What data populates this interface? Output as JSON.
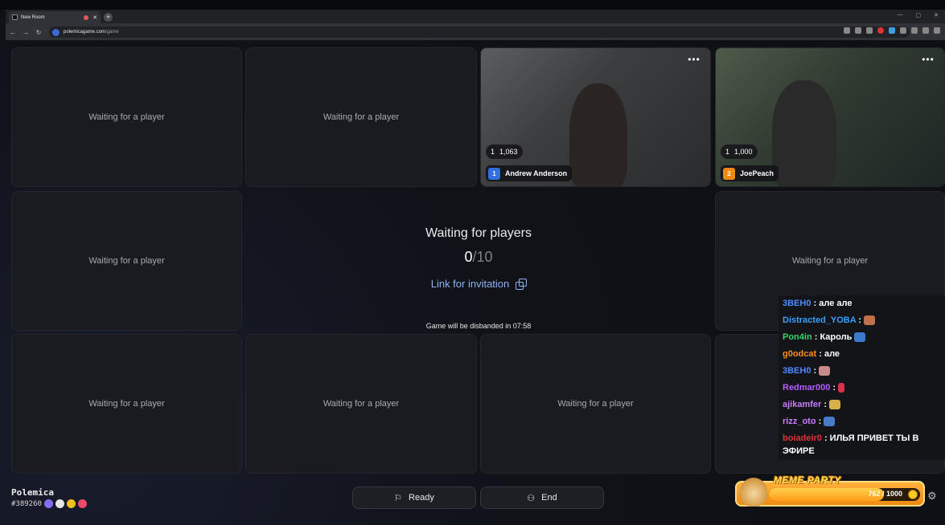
{
  "browser": {
    "tab_title": "New Room",
    "url_host": "polemicagame.com",
    "url_path": "/game",
    "newtab_glyph": "+",
    "tab_close_glyph": "✕"
  },
  "tiles": {
    "waiting_text": "Waiting for a player"
  },
  "players": [
    {
      "number": "1",
      "name": "Andrew Anderson",
      "lives": "1",
      "score": "1,063",
      "badge_color": "#2f6fe0"
    },
    {
      "number": "2",
      "name": "JoePeach",
      "lives": "1",
      "score": "1,000",
      "badge_color": "#f08a10"
    }
  ],
  "center": {
    "title": "Waiting for players",
    "count_current": "0",
    "count_total": "/10",
    "invite_label": "Link for invitation",
    "disband_text": "Game will be disbanded in 07:58"
  },
  "profile": {
    "name": "Polemica",
    "id": "#389260"
  },
  "controls": {
    "ready_label": "Ready",
    "end_label": "End"
  },
  "chat": [
    {
      "user": "3BEH0",
      "text": " : але але",
      "color": "#4a8cff"
    },
    {
      "user": "Distracted_YOBA",
      "text": " :",
      "color": "#3aa0ff",
      "emote": "#c0704a"
    },
    {
      "user": "Pon4in",
      "text": " : Кароль",
      "color": "#36d46b",
      "emote": "#3d7acb"
    },
    {
      "user": "g0odcat",
      "text": " : але",
      "color": "#ff8c1a"
    },
    {
      "user": "3BEH0",
      "text": " :",
      "color": "#4a8cff",
      "emote": "#c88a8a"
    },
    {
      "user": "Redmar000",
      "text": " :",
      "color": "#b45cff",
      "emote": "#d9324a"
    },
    {
      "user": "ajikamfer",
      "text": " :",
      "color": "#c47bff",
      "emote": "#d8b04a"
    },
    {
      "user": "rizz_oto",
      "text": " :",
      "color": "#d07bff",
      "emote": "#4a7bcb"
    },
    {
      "user": "boiadeir0",
      "text": " : ИЛЬЯ ПРИВЕТ ТЫ В ЭФИРЕ",
      "color": "#e0303a"
    }
  ],
  "meme_party": {
    "title": "MEME PARTY",
    "current": "762",
    "total": " / 1000",
    "progress": 0.762
  }
}
